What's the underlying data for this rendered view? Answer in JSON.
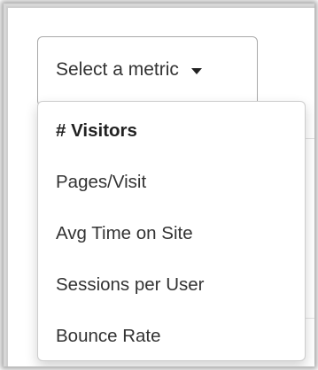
{
  "select": {
    "label": "Select a metric"
  },
  "menu": {
    "items": [
      {
        "label": "# Visitors",
        "selected": true
      },
      {
        "label": "Pages/Visit",
        "selected": false
      },
      {
        "label": "Avg Time on Site",
        "selected": false
      },
      {
        "label": "Sessions per User",
        "selected": false
      },
      {
        "label": "Bounce Rate",
        "selected": false
      }
    ]
  },
  "icons": {
    "dropdown": "caret-down-icon"
  },
  "colors": {
    "text": "#333333",
    "border": "#a9a9a9",
    "menu_border": "#cdcdcd"
  }
}
